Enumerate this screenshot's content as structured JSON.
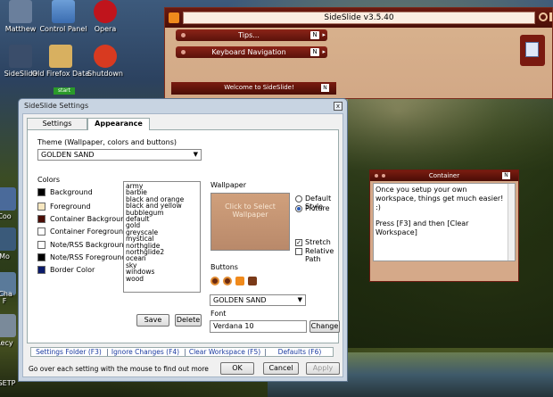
{
  "desktop": {
    "icons": [
      {
        "label": "Matthew",
        "icon": "user-folder-icon"
      },
      {
        "label": "Control Panel",
        "icon": "control-panel-icon"
      },
      {
        "label": "Opera",
        "icon": "opera-icon"
      },
      {
        "label": "SideSlide",
        "icon": "sideslide-icon"
      },
      {
        "label": "Old Firefox Data",
        "icon": "folder-icon"
      },
      {
        "label": "Shutdown",
        "icon": "shutdown-icon"
      },
      {
        "label": "Coo",
        "icon": "app-icon"
      },
      {
        "label": "Mo",
        "icon": "app-icon"
      },
      {
        "label": "F",
        "icon": "app-icon"
      },
      {
        "label": "iCha",
        "icon": "app-icon"
      },
      {
        "label": "Recy",
        "icon": "recycle-bin-icon"
      },
      {
        "label": "ESETP",
        "icon": "app-icon"
      }
    ],
    "start_label": "start"
  },
  "sideslide": {
    "title": "SideSlide v3.5.40",
    "tips_label": "Tips...",
    "keyboard_label": "Keyboard Navigation",
    "n_badge": "N",
    "welcome_title": "Welcome to SideSlide!",
    "container_title": "Container",
    "container_text_line1": "Once you setup your own workspace, things get much easier! :)",
    "container_text_line2": "Press [F3] and then [Clear Workspace]"
  },
  "dialog": {
    "title": "SideSlide Settings",
    "close_label": "x",
    "tabs": [
      {
        "label": "Settings"
      },
      {
        "label": "Appearance"
      }
    ],
    "theme_label": "Theme (Wallpaper, colors and buttons)",
    "theme_value": "GOLDEN SAND",
    "colors_label": "Colors",
    "colors": [
      {
        "label": "Background",
        "swatch": "#000000"
      },
      {
        "label": "Foreground",
        "swatch": "#f7e7c0"
      },
      {
        "label": "Container Background",
        "swatch": "#4a0d06"
      },
      {
        "label": "Container Foreground",
        "swatch": "#ffffff"
      },
      {
        "label": "Note/RSS Background",
        "swatch": "#ffffff"
      },
      {
        "label": "Note/RSS Foreground",
        "swatch": "#000000"
      },
      {
        "label": "Border Color",
        "swatch": "#0a1a6a"
      }
    ],
    "theme_list": [
      "army",
      "barbie",
      "black and orange",
      "black and yellow",
      "bubblegum",
      "default",
      "gold",
      "greyscale",
      "mystical",
      "northglide",
      "northglide2",
      "ocean",
      "sky",
      "windows",
      "wood"
    ],
    "save_label": "Save",
    "delete_label": "Delete",
    "wallpaper_label": "Wallpaper",
    "wallpaper_hint": "Click to Select Wallpaper",
    "default_style_label": "Default Style",
    "picture_label": "Picture",
    "stretch_label": "Stretch",
    "relative_path_label": "Relative Path",
    "buttons_label": "Buttons",
    "buttons_value": "GOLDEN SAND",
    "font_label": "Font",
    "font_value": "Verdana 10",
    "change_label": "Change",
    "links": [
      {
        "label": "Settings Folder (F3)"
      },
      {
        "label": "Ignore Changes (F4)"
      },
      {
        "label": "Clear Workspace (F5)"
      },
      {
        "label": "Defaults (F6)"
      }
    ],
    "status_text": "Go over each setting with the mouse to find out more",
    "ok_label": "OK",
    "cancel_label": "Cancel",
    "apply_label": "Apply"
  }
}
